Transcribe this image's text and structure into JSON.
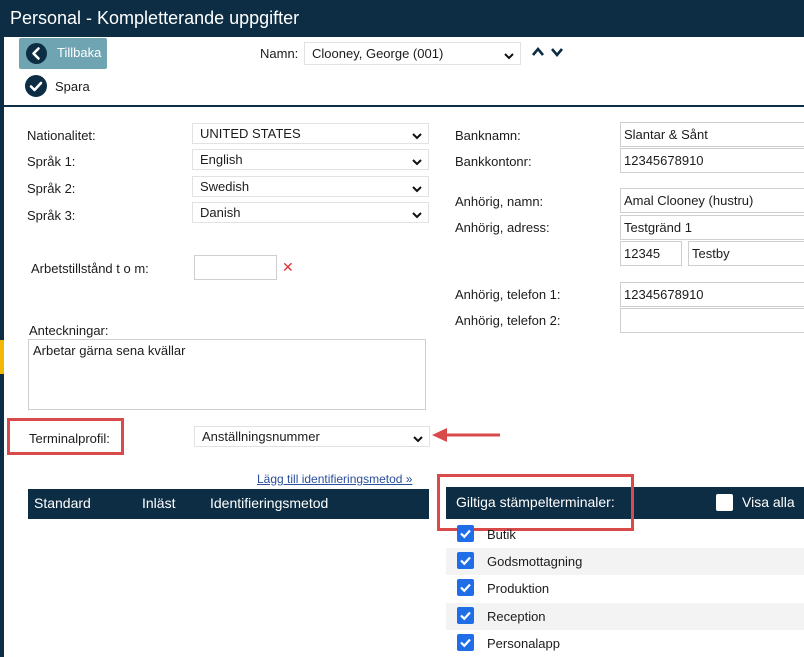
{
  "window": {
    "title": "Personal - Kompletterande uppgifter"
  },
  "toolbar": {
    "back_label": "Tillbaka",
    "save_label": "Spara",
    "name_label": "Namn:",
    "name_value": "Clooney, George (001)"
  },
  "left_form": {
    "nationality_label": "Nationalitet:",
    "nationality_value": "UNITED STATES",
    "language1_label": "Språk 1:",
    "language1_value": "English",
    "language2_label": "Språk 2:",
    "language2_value": "Swedish",
    "language3_label": "Språk 3:",
    "language3_value": "Danish",
    "work_permit_label": "Arbetstillstånd t o m:",
    "work_permit_value": "",
    "notes_label": "Anteckningar:",
    "notes_value": "Arbetar gärna sena kvällar",
    "terminal_profile_label": "Terminalprofil:",
    "terminal_profile_value": "Anställningsnummer"
  },
  "right_form": {
    "bank_name_label": "Banknamn:",
    "bank_name_value": "Slantar & Sånt",
    "bank_account_label": "Bankkontonr:",
    "bank_account_value": "12345678910",
    "relative_name_label": "Anhörig, namn:",
    "relative_name_value": "Amal Clooney (hustru)",
    "relative_address_label": "Anhörig, adress:",
    "relative_street_value": "Testgränd 1",
    "relative_zip_value": "12345",
    "relative_city_value": "Testby",
    "relative_phone1_label": "Anhörig, telefon 1:",
    "relative_phone1_value": "12345678910",
    "relative_phone2_label": "Anhörig, telefon 2:",
    "relative_phone2_value": ""
  },
  "identification": {
    "add_link": "Lägg till identifieringsmetod »",
    "columns": [
      "Standard",
      "Inläst",
      "Identifieringsmetod"
    ]
  },
  "terminals": {
    "header": "Giltiga stämpelterminaler:",
    "show_all_label": "Visa alla",
    "show_all_checked": false,
    "items": [
      {
        "label": "Butik",
        "checked": true
      },
      {
        "label": "Godsmottagning",
        "checked": true
      },
      {
        "label": "Produktion",
        "checked": true
      },
      {
        "label": "Reception",
        "checked": true
      },
      {
        "label": "Personalapp",
        "checked": true
      }
    ]
  },
  "colors": {
    "header_bg": "#0c2d44",
    "back_button_bg": "#6fa4b3",
    "checkbox_blue": "#1f6ee8",
    "highlight_red": "#d94b4b",
    "link_blue": "#2a4f9c",
    "side_accent": "#f2b705"
  },
  "icons": {
    "back": "arrow-left-circle-icon",
    "save": "check-circle-icon",
    "prev": "chevron-up-icon",
    "next": "chevron-down-icon",
    "clear": "close-x-icon",
    "checkbox": "checkbox-checked-icon"
  }
}
